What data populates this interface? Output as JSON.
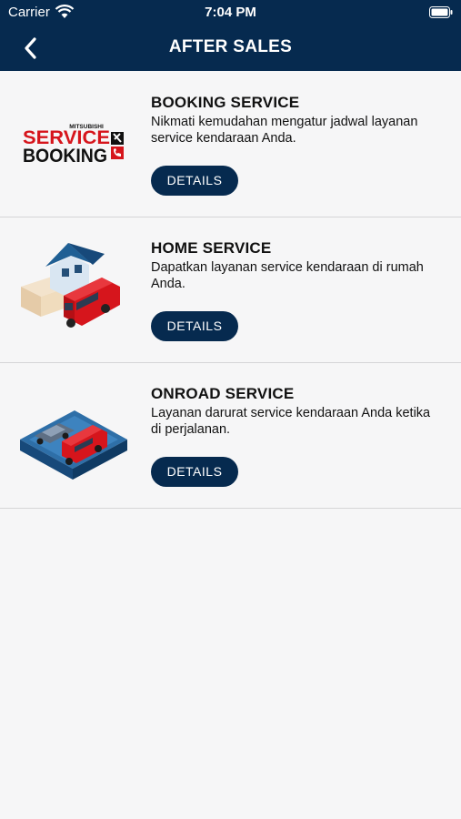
{
  "status_bar": {
    "carrier": "Carrier",
    "time": "7:04 PM"
  },
  "header": {
    "title": "AFTER SALES"
  },
  "logo": {
    "brand": "MITSUBISHI",
    "line1": "SERVICE",
    "line2": "BOOKING"
  },
  "services": [
    {
      "title": "BOOKING SERVICE",
      "description": "Nikmati kemudahan mengatur jadwal layanan service kendaraan Anda.",
      "button": "DETAILS"
    },
    {
      "title": "HOME SERVICE",
      "description": "Dapatkan layanan service kendaraan di rumah Anda.",
      "button": "DETAILS"
    },
    {
      "title": "ONROAD SERVICE",
      "description": "Layanan darurat service kendaraan Anda ketika di perjalanan.",
      "button": "DETAILS"
    }
  ],
  "colors": {
    "navy": "#062a4f",
    "red": "#d6151c",
    "background": "#f6f6f7"
  }
}
